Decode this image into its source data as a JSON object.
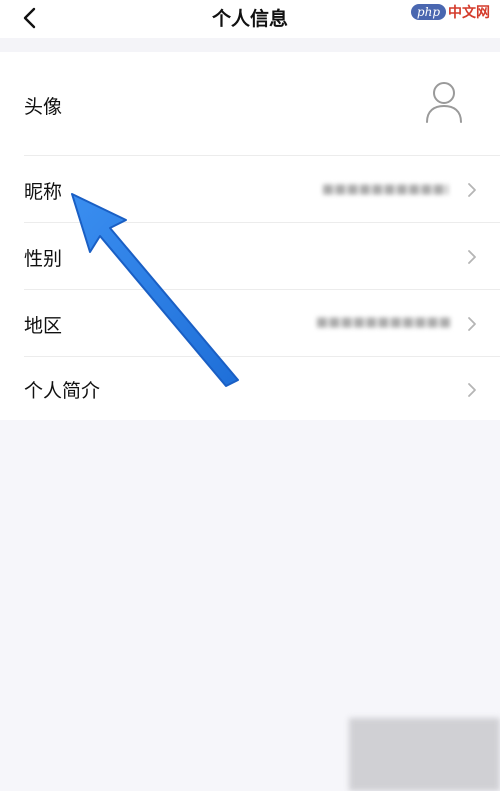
{
  "header": {
    "title": "个人信息",
    "watermark_badge": "php",
    "watermark_text": "中文网"
  },
  "rows": [
    {
      "label": "头像"
    },
    {
      "label": "昵称",
      "value": "■■■■■■■■■■■■■"
    },
    {
      "label": "性别"
    },
    {
      "label": "地区",
      "value": "■■■■■■■■■■■■■"
    },
    {
      "label": "个人简介"
    }
  ],
  "colors": {
    "background": "#f6f6fa",
    "list_background": "#ffffff",
    "arrow": "#2a7de6",
    "chevron": "#b5b5b5"
  },
  "icons": [
    "back-chevron-icon",
    "avatar-placeholder-icon",
    "chevron-right-icon",
    "annotation-arrow-icon"
  ]
}
